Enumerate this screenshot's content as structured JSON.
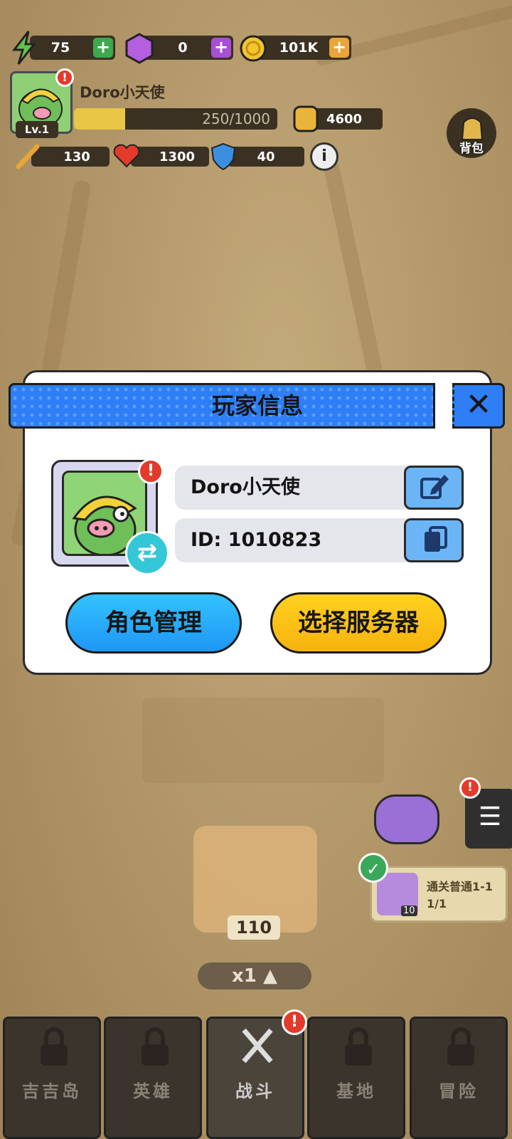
{
  "hud": {
    "energy": "75",
    "gems": "0",
    "coins": "101K",
    "player_name": "Doro小天使",
    "level": "Lv.1",
    "xp_text": "250/1000",
    "xp_fraction": 0.25,
    "power": "4600",
    "attack": "130",
    "hp": "1300",
    "defense": "40",
    "bag_label": "背包",
    "info_icon": "info-icon"
  },
  "dialog": {
    "title": "玩家信息",
    "name": "Doro小天使",
    "id_text": "ID: 1010823",
    "alert": "!",
    "role_button": "角色管理",
    "server_button": "选择服务器"
  },
  "scene": {
    "quest_title": "通关普通1-1",
    "quest_progress": "1/1",
    "quest_item_count": "10",
    "chest_count": "110",
    "speed": "x1 ▲"
  },
  "nav": {
    "tabs": [
      {
        "label": "吉吉岛"
      },
      {
        "label": "英雄"
      },
      {
        "label": "战斗"
      },
      {
        "label": "基地"
      },
      {
        "label": "冒险"
      }
    ],
    "alert": "!"
  },
  "colors": {
    "header_blue": "#2d7ef7",
    "button_blue": "#1f96f5",
    "button_yellow": "#f7b20f",
    "alert_red": "#e43a2b"
  }
}
